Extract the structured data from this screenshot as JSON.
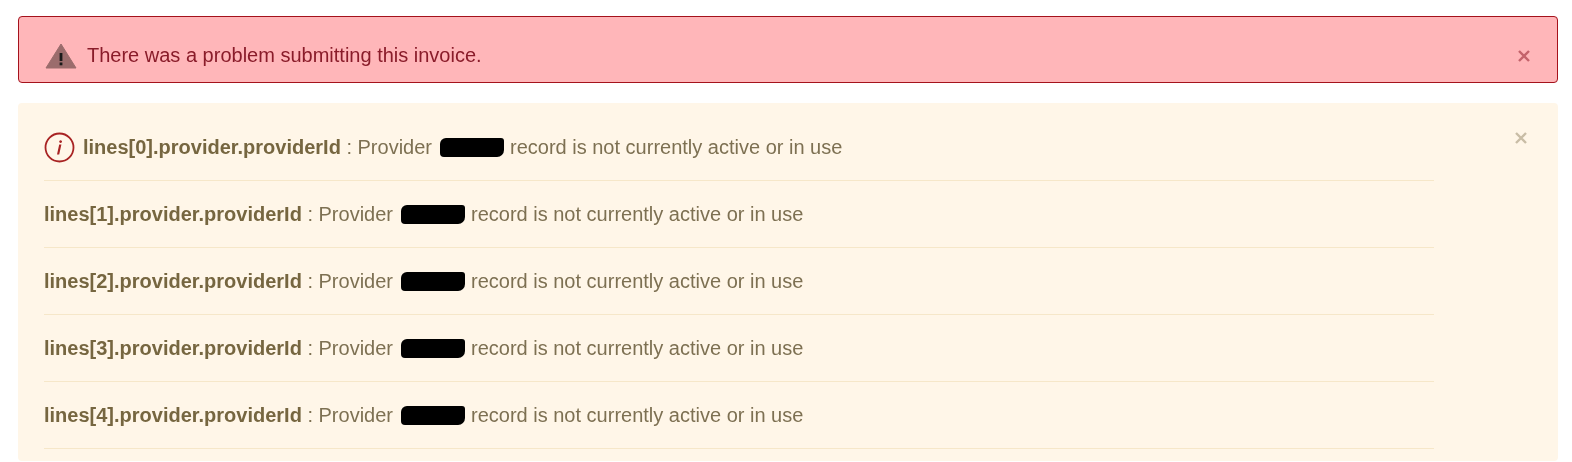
{
  "error_alert": {
    "message": "There was a problem submitting this invoice.",
    "dismissible": true
  },
  "validation_panel": {
    "dismissible": true,
    "errors": [
      {
        "field": "lines[0].provider.providerId",
        "message_start": ": Provider",
        "message_end": "record is not currently active or in use",
        "redacted": true
      },
      {
        "field": "lines[1].provider.providerId",
        "message_start": ": Provider",
        "message_end": "record is not currently active or in use",
        "redacted": true
      },
      {
        "field": "lines[2].provider.providerId",
        "message_start": ": Provider",
        "message_end": "record is not currently active or in use",
        "redacted": true
      },
      {
        "field": "lines[3].provider.providerId",
        "message_start": ": Provider",
        "message_end": "record is not currently active or in use",
        "redacted": true
      },
      {
        "field": "lines[4].provider.providerId",
        "message_start": ": Provider",
        "message_end": "record is not currently active or in use",
        "redacted": true
      }
    ]
  }
}
